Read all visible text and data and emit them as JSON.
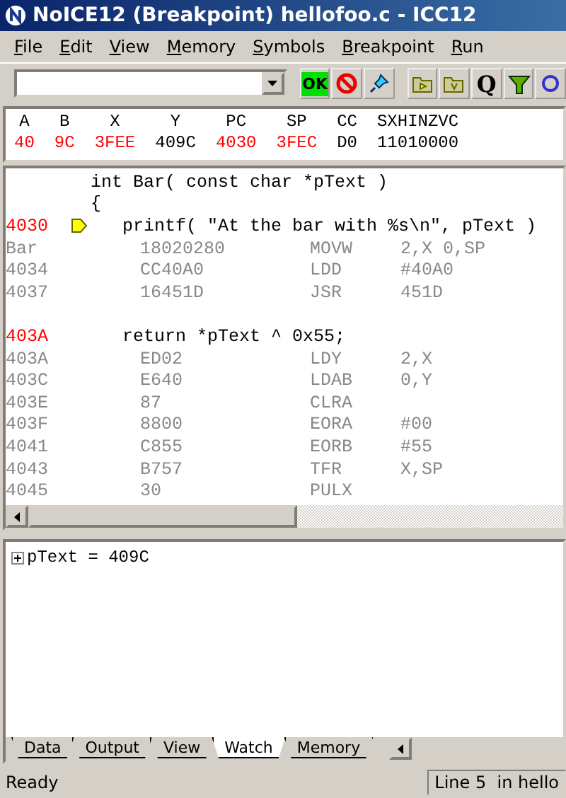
{
  "window": {
    "title": "NoICE12 (Breakpoint) hellofoo.c - ICC12"
  },
  "menu": [
    "File",
    "Edit",
    "View",
    "Memory",
    "Symbols",
    "Breakpoint",
    "Run"
  ],
  "toolbar": {
    "ok_label": "OK",
    "q_label": "Q"
  },
  "registers": [
    {
      "name": "A",
      "value": "40",
      "changed": true
    },
    {
      "name": "B",
      "value": "9C",
      "changed": true
    },
    {
      "name": "X",
      "value": "3FEE",
      "changed": true
    },
    {
      "name": "Y",
      "value": "409C",
      "changed": false
    },
    {
      "name": "PC",
      "value": "4030",
      "changed": true
    },
    {
      "name": "SP",
      "value": "3FEC",
      "changed": true
    },
    {
      "name": "CC",
      "value": "D0",
      "changed": false
    },
    {
      "name": "SXHINZVC",
      "value": "11010000",
      "changed": false
    }
  ],
  "code": [
    {
      "kind": "source",
      "text": "int Bar( const char *pText )",
      "current": false
    },
    {
      "kind": "source",
      "text": "{",
      "current": false
    },
    {
      "kind": "source",
      "address": "4030",
      "text": "   printf( \"At the bar with %s\\n\", pText )",
      "current": true
    },
    {
      "kind": "asm",
      "address": "Bar",
      "bytes": "18020280",
      "mnemonic": "MOVW",
      "operand": "2,X 0,SP"
    },
    {
      "kind": "asm",
      "address": "4034",
      "bytes": "CC40A0",
      "mnemonic": "LDD",
      "operand": "#40A0"
    },
    {
      "kind": "asm",
      "address": "4037",
      "bytes": "16451D",
      "mnemonic": "JSR",
      "operand": "451D"
    },
    {
      "kind": "blank"
    },
    {
      "kind": "source",
      "address": "403A",
      "text": "   return *pText ^ 0x55;",
      "current": false
    },
    {
      "kind": "asm",
      "address": "403A",
      "bytes": "ED02",
      "mnemonic": "LDY",
      "operand": "2,X"
    },
    {
      "kind": "asm",
      "address": "403C",
      "bytes": "E640",
      "mnemonic": "LDAB",
      "operand": "0,Y"
    },
    {
      "kind": "asm",
      "address": "403E",
      "bytes": "87",
      "mnemonic": "CLRA"
    },
    {
      "kind": "asm",
      "address": "403F",
      "bytes": "8800",
      "mnemonic": "EORA",
      "operand": "#00"
    },
    {
      "kind": "asm",
      "address": "4041",
      "bytes": "C855",
      "mnemonic": "EORB",
      "operand": "#55"
    },
    {
      "kind": "asm",
      "address": "4043",
      "bytes": "B757",
      "mnemonic": "TFR",
      "operand": "X,SP"
    },
    {
      "kind": "asm",
      "address": "4045",
      "bytes": "30",
      "mnemonic": "PULX"
    }
  ],
  "watch": [
    {
      "text": "pText = 409C",
      "expanded": false
    }
  ],
  "tabs": [
    {
      "label": "Data",
      "selected": false
    },
    {
      "label": "Output",
      "selected": false
    },
    {
      "label": "View",
      "selected": false
    },
    {
      "label": "Watch",
      "selected": true
    },
    {
      "label": "Memory",
      "selected": false
    }
  ],
  "status_bar": {
    "message": "Ready",
    "position": "Line 5  in hello"
  }
}
